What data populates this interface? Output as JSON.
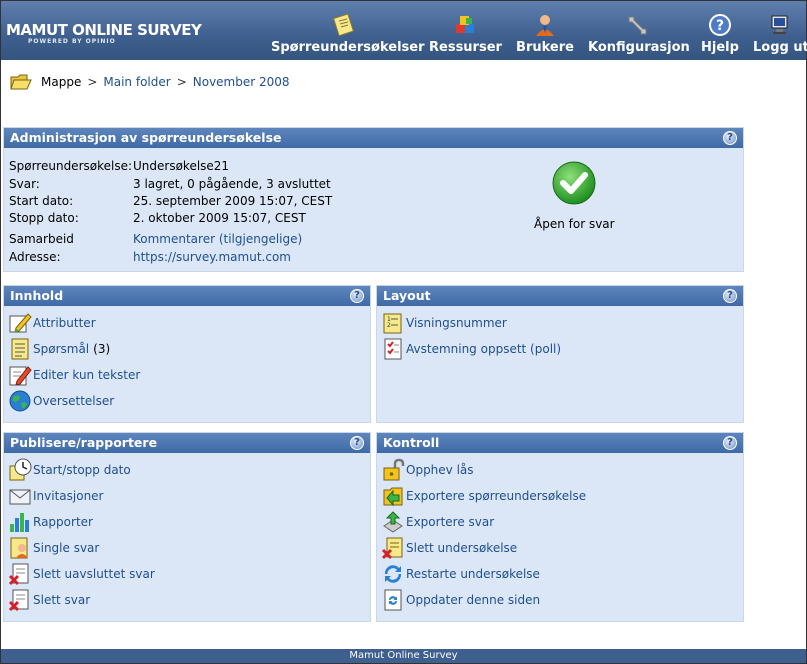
{
  "app": {
    "logo_title": "MAMUT ONLINE SURVEY",
    "logo_sub": "POWERED BY OPINIO"
  },
  "nav": [
    {
      "label": "Spørreundersøkelser",
      "icon": "survey-notepad-icon"
    },
    {
      "label": "Ressurser",
      "icon": "resources-blocks-icon"
    },
    {
      "label": "Brukere",
      "icon": "users-person-icon"
    },
    {
      "label": "Konfigurasjon",
      "icon": "wrench-icon"
    },
    {
      "label": "Hjelp",
      "icon": "help-icon"
    },
    {
      "label": "Logg ut",
      "icon": "logout-computer-icon"
    }
  ],
  "breadcrumb": {
    "root": "Mappe",
    "sep": ">",
    "items": [
      "Main folder",
      "November 2008"
    ]
  },
  "admin": {
    "title": "Administrasjon av spørreundersøkelse",
    "rows": [
      {
        "key": "Spørreundersøkelse:",
        "value": "Undersøkelse21"
      },
      {
        "key": "Svar:",
        "value": "3 lagret, 0 pågående, 3 avsluttet"
      },
      {
        "key": "Start dato:",
        "value": "25. september 2009 15:07, CEST"
      },
      {
        "key": "Stopp dato:",
        "value": "2. oktober 2009 15:07, CEST"
      },
      {
        "key": "Samarbeid",
        "value": "Kommentarer (tilgjengelige)"
      },
      {
        "key": "Adresse:",
        "value": "https://survey.mamut.com"
      }
    ],
    "status_text": "Åpen for svar"
  },
  "innhold": {
    "title": "Innhold",
    "items": [
      {
        "label": "Attributter",
        "icon": "pencil-edit-icon"
      },
      {
        "label": "Spørsmål",
        "count": "(3)",
        "icon": "questions-list-icon"
      },
      {
        "label": "Editer kun tekster",
        "icon": "edit-text-icon"
      },
      {
        "label": "Oversettelser",
        "icon": "globe-icon"
      }
    ]
  },
  "layout": {
    "title": "Layout",
    "items": [
      {
        "label": "Visningsnummer",
        "icon": "numbered-list-icon"
      },
      {
        "label": "Avstemning oppsett (poll)",
        "icon": "poll-checklist-icon"
      }
    ]
  },
  "publisere": {
    "title": "Publisere/rapportere",
    "items": [
      {
        "label": "Start/stopp dato",
        "icon": "clock-icon"
      },
      {
        "label": "Invitasjoner",
        "icon": "envelope-icon"
      },
      {
        "label": "Rapporter",
        "icon": "bar-chart-icon"
      },
      {
        "label": "Single svar",
        "icon": "single-response-icon"
      },
      {
        "label": "Slett uavsluttet svar",
        "icon": "delete-document-icon"
      },
      {
        "label": "Slett svar",
        "icon": "delete-document-icon"
      }
    ]
  },
  "kontroll": {
    "title": "Kontroll",
    "items": [
      {
        "label": "Opphev lås",
        "icon": "unlock-icon"
      },
      {
        "label": "Exportere spørreundersøkelse",
        "icon": "export-folder-icon"
      },
      {
        "label": "Exportere svar",
        "icon": "export-arrow-icon"
      },
      {
        "label": "Slett undersøkelse",
        "icon": "delete-survey-icon"
      },
      {
        "label": "Restarte undersøkelse",
        "icon": "restart-icon"
      },
      {
        "label": "Oppdater denne siden",
        "icon": "refresh-page-icon"
      }
    ]
  },
  "help_glyph": "?",
  "footer": "Mamut Online Survey"
}
